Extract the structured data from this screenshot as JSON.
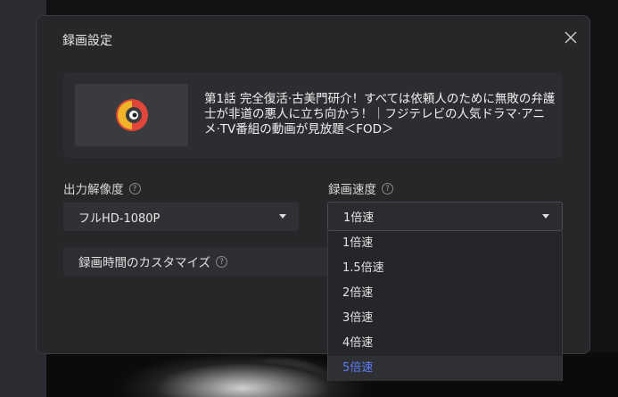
{
  "dialog": {
    "title": "録画設定"
  },
  "video": {
    "title": "第1話 完全復活·古美門研介！すべては依頼人のために無敗の弁護士が非道の悪人に立ち向かう！｜フジテレビの人気ドラマ·アニメ·TV番組の動画が見放題＜FOD＞"
  },
  "resolution": {
    "label": "出力解像度",
    "value": "フルHD-1080P"
  },
  "speed": {
    "label": "録画速度",
    "value": "1倍速",
    "options": [
      "1倍速",
      "1.5倍速",
      "2倍速",
      "3倍速",
      "4倍速",
      "5倍速"
    ],
    "highlighted_index": 5
  },
  "custom_time": {
    "label": "録画時間のカスタマイズ"
  },
  "help_glyph": "?",
  "colors": {
    "accent": "#5b7cf5",
    "dialog_bg": "#262729"
  },
  "icons": {
    "close": "close-icon",
    "help": "question-circle-icon",
    "caret": "caret-down-icon",
    "thumbnail": "player-logo-icon"
  }
}
